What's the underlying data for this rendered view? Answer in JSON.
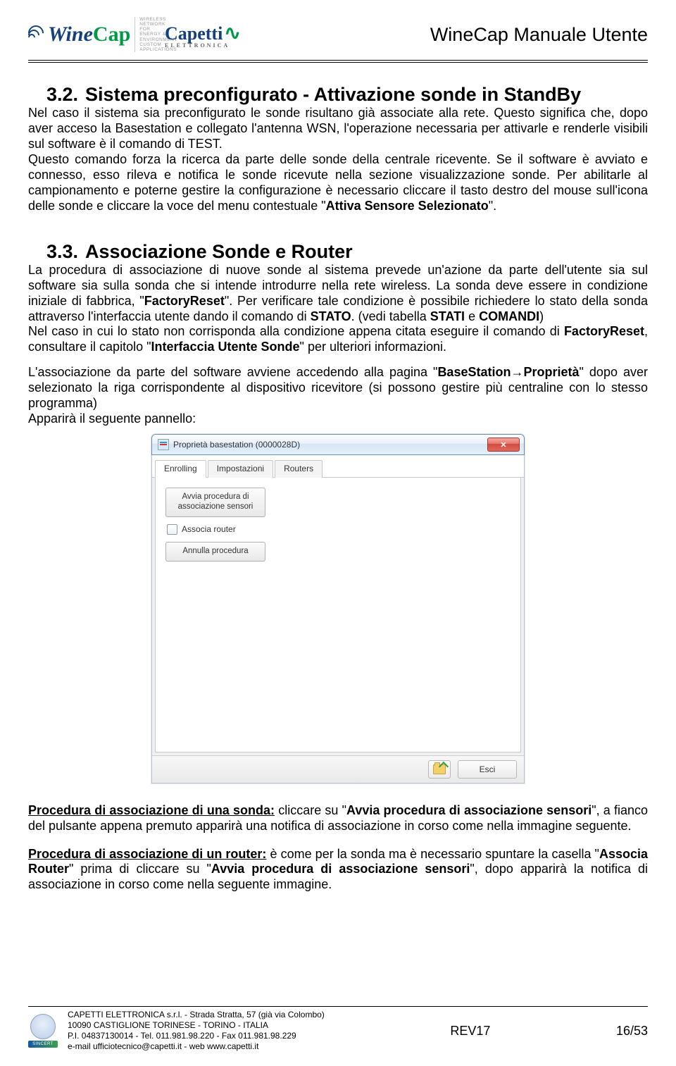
{
  "header": {
    "logo1_name": "Wine",
    "logo1_suffix": "Cap",
    "logo1_tag": "WIRELESS\nNETWORK FOR\nENERGY &\nENVIRONMENT\nCUSTOM\nAPPLICATIONS",
    "logo2_name": "Capetti",
    "logo2_sub": "ELETTRONICA",
    "title": "WineCap Manuale Utente"
  },
  "section32": {
    "num": "3.2.",
    "title": "Sistema preconfigurato - Attivazione sonde in StandBy",
    "p1a": "Nel caso il sistema sia preconfigurato le sonde risultano già associate alla rete. Questo significa che, dopo aver acceso la Basestation e collegato l'antenna WSN, l'operazione necessaria per attivarle e renderle visibili sul software è il comando di TEST.",
    "p1b": "Questo comando forza la ricerca da parte delle sonde della centrale ricevente. Se il software è avviato e connesso, esso rileva e notifica le sonde ricevute nella sezione visualizzazione sonde. Per abilitarle al campionamento e poterne gestire la configurazione è necessario cliccare il tasto destro del mouse sull'icona delle sonde e cliccare la voce del menu contestuale \"",
    "p1b_bold": "Attiva Sensore Selezionato",
    "p1b_end": "\"."
  },
  "section33": {
    "num": "3.3.",
    "title": "Associazione Sonde e Router",
    "p1a": "La procedura di associazione di nuove sonde al sistema prevede un'azione da parte dell'utente sia sul software sia sulla sonda che si intende introdurre nella rete wireless. La sonda deve essere in condizione iniziale di fabbrica, \"",
    "p1a_b1": "FactoryReset",
    "p1a_mid": "\". Per verificare tale condizione è possibile richiedere lo stato della sonda attraverso l'interfaccia utente dando il comando di ",
    "p1a_b2": "STATO",
    "p1a_mid2": ". (vedi tabella ",
    "p1a_b3": "STATI",
    "p1a_mid3": " e ",
    "p1a_b4": "COMANDI",
    "p1a_end": ")",
    "p1line2a": "Nel caso in cui lo stato non corrisponda alla condizione appena citata eseguire il comando di ",
    "p1line2b": "FactoryReset",
    "p1line2c": ", consultare il capitolo \"",
    "p1line2d": "Interfaccia Utente Sonde",
    "p1line2e": "\" per ulteriori informazioni.",
    "p2a": "L'associazione da parte del software avviene accedendo alla pagina \"",
    "p2b": "BaseStation",
    "p2arrow": "→",
    "p2c": "Proprietà",
    "p2d": "\" dopo aver selezionato la riga corrispondente al dispositivo ricevitore (si possono gestire più centraline con lo stesso programma)",
    "p2e": "Apparirà il seguente pannello:"
  },
  "dialog": {
    "title": "Proprietà basestation  (0000028D)",
    "tabs": [
      "Enrolling",
      "Impostazioni",
      "Routers"
    ],
    "btn1": "Avvia procedura di associazione sensori",
    "chk": "Associa router",
    "btn2": "Annulla procedura",
    "esci": "Esci"
  },
  "afterDialog": {
    "p1_u": "Procedura di associazione di una sonda:",
    "p1a": " cliccare su \"",
    "p1b": "Avvia procedura di associazione sensori",
    "p1c": "\", a fianco del pulsante appena premuto apparirà una notifica di associazione in corso come nella immagine seguente.",
    "p2_u": "Procedura di associazione di un router:",
    "p2a": " è come per la sonda ma è necessario spuntare la casella \"",
    "p2b": "Associa Router",
    "p2c": "\" prima di cliccare su \"",
    "p2d": "Avvia procedura di associazione sensori",
    "p2e": "\", dopo apparirà la notifica di associazione in corso come nella seguente immagine."
  },
  "footer": {
    "addr1": "CAPETTI ELETTRONICA s.r.l.   -   Strada Stratta, 57 (già via Colombo)",
    "addr2": "10090 CASTIGLIONE TORINESE  -  TORINO  -  ITALIA",
    "addr3": "P.I. 04837130014 - Tel. 011.981.98.220 -  Fax 011.981.98.229",
    "addr4": "e-mail ufficiotecnico@capetti.it   -   web www.capetti.it",
    "rev": "REV17",
    "page": "16/53",
    "sealbar": "SINCERT"
  }
}
